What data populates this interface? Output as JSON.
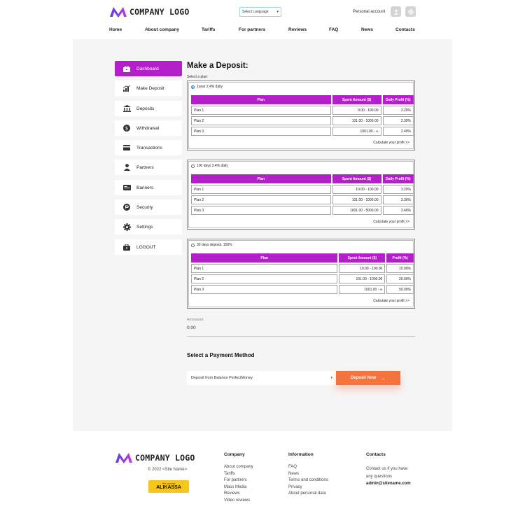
{
  "header": {
    "logo_text": "COMPANY LOGO",
    "language_select": "Select Language",
    "personal_account": "Personal account",
    "nav": [
      "Home",
      "About company",
      "Tariffs",
      "For partners",
      "Reviews",
      "FAQ",
      "News",
      "Contacts"
    ]
  },
  "colors": {
    "accent": "#b31fc9",
    "cta": "#f5733c",
    "background": "#f5f5f5"
  },
  "sidebar": {
    "items": [
      {
        "label": "Dashboard",
        "icon": "briefcase-icon",
        "active": true
      },
      {
        "label": "Make Deposit",
        "icon": "chart-icon",
        "active": false
      },
      {
        "label": "Deposits",
        "icon": "bank-icon",
        "active": false
      },
      {
        "label": "Withdrawal",
        "icon": "dollar-icon",
        "active": false
      },
      {
        "label": "Transactions",
        "icon": "card-icon",
        "active": false
      },
      {
        "label": "Partners",
        "icon": "user-icon",
        "active": false
      },
      {
        "label": "Banners",
        "icon": "banner-icon",
        "active": false
      },
      {
        "label": "Security",
        "icon": "shield-icon",
        "active": false
      },
      {
        "label": "Settings",
        "icon": "gear-icon",
        "active": false
      },
      {
        "label": "LOGOUT",
        "icon": "logout-icon",
        "active": false
      }
    ]
  },
  "deposit": {
    "title": "Make a Deposit:",
    "select_plan_label": "Select a plan:",
    "calc_link": "Calculate your profit >>",
    "plans": [
      {
        "name": "1year 2.4% daily",
        "checked": true,
        "headers": [
          "Plan",
          "Spent Amount ($)",
          "Daily Profit (%)"
        ],
        "rows": [
          [
            "Plan 1",
            "0.00 - 100.00",
            "2.20%"
          ],
          [
            "Plan 2",
            "101.00 - 1000.00",
            "2.30%"
          ],
          [
            "Plan 3",
            "1001.00 - ∞",
            "2.40%"
          ]
        ]
      },
      {
        "name": "100 days 3.4% daily",
        "checked": false,
        "headers": [
          "Plan",
          "Spent Amount ($)",
          "Daily Profit (%)"
        ],
        "rows": [
          [
            "Plan 1",
            "10.00 - 100.00",
            "3.20%"
          ],
          [
            "Plan 2",
            "101.00 - 1000.00",
            "3.30%"
          ],
          [
            "Plan 3",
            "1001.00 - 5000.00",
            "3.40%"
          ]
        ]
      },
      {
        "name": "30 days deposit. 150%",
        "checked": false,
        "headers": [
          "Plan",
          "Spent Amount ($)",
          "Profit (%)"
        ],
        "rows": [
          [
            "Plan 1",
            "10.00 - 100.00",
            "10.00%"
          ],
          [
            "Plan 2",
            "101.00 - 1000.00",
            "20.00%"
          ],
          [
            "Plan 3",
            "1001.00 - ∞",
            "50.00%"
          ]
        ]
      }
    ],
    "amount_label": "Ammount",
    "amount_value": "0.00",
    "payment_title": "Select a Payment Method",
    "payment_option": "Deposit from Balance PerfectMoney",
    "deposit_button": "Deposit Now"
  },
  "footer": {
    "logo_text": "COMPANY LOGO",
    "copyright": "© 2022 <Site Name>",
    "badge_small": "We accept",
    "badge_big": "ALIKASSA",
    "company": {
      "title": "Company",
      "links": [
        "About company",
        "Tariffs",
        "For partners",
        "Mass Media",
        "Reviews",
        "Video reviews"
      ]
    },
    "information": {
      "title": "Information",
      "links": [
        "FAQ",
        "News",
        "Terms and conditions",
        "Privacy",
        "About personal data"
      ]
    },
    "contacts": {
      "title": "Contacts",
      "line1": "Contact us if you have",
      "line2": "any questions",
      "email": "admin@sitename.com"
    }
  }
}
